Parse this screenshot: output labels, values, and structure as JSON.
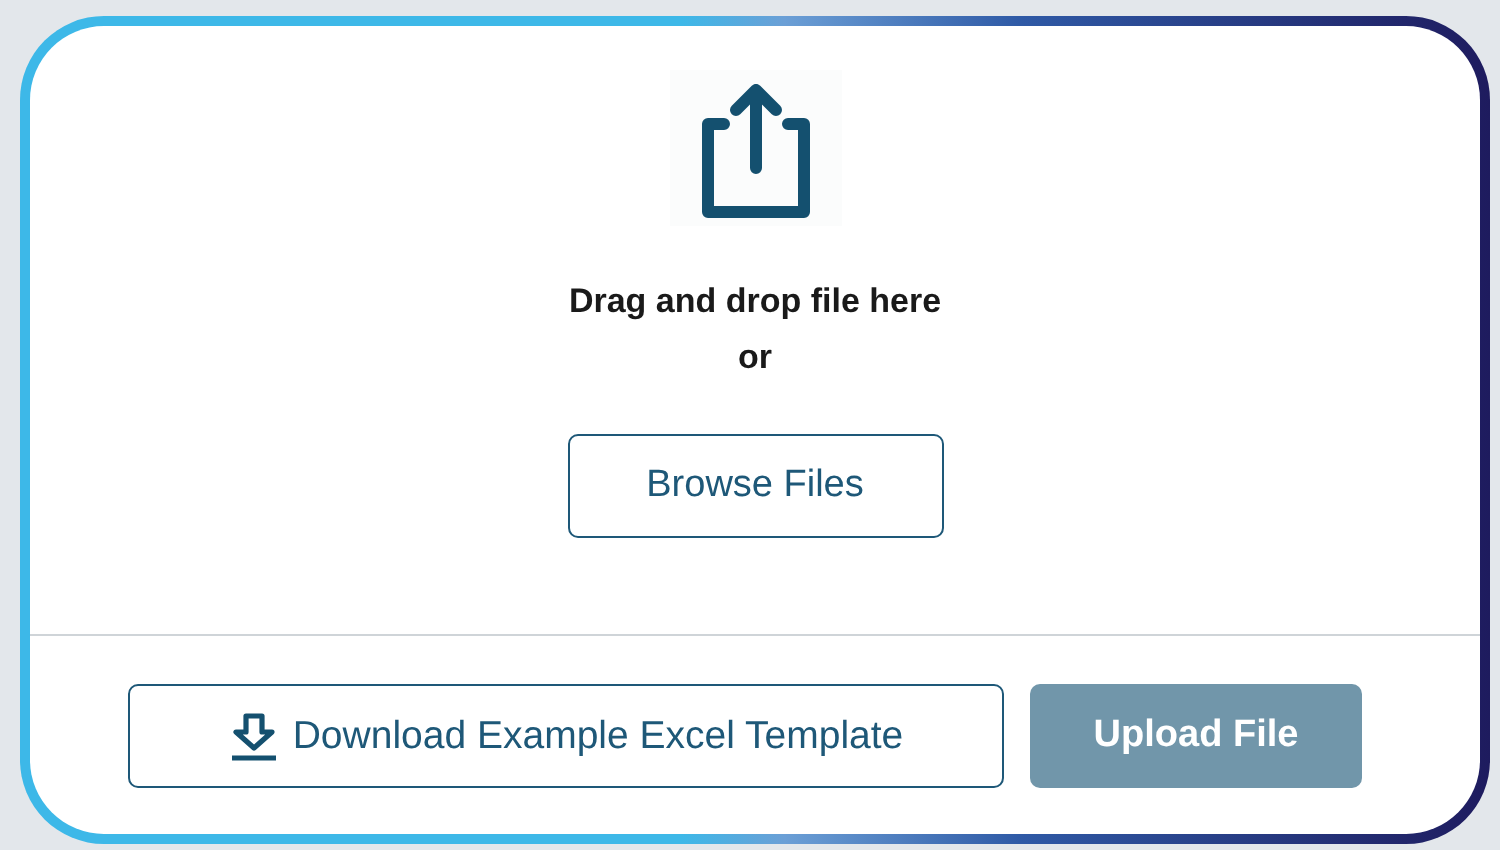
{
  "dropzone": {
    "prompt": "Drag and drop file here",
    "separator": "or",
    "browse_button": "Browse Files"
  },
  "footer": {
    "download_button": "Download Example Excel Template",
    "upload_button": {
      "label": "Upload File",
      "disabled": true
    }
  }
}
